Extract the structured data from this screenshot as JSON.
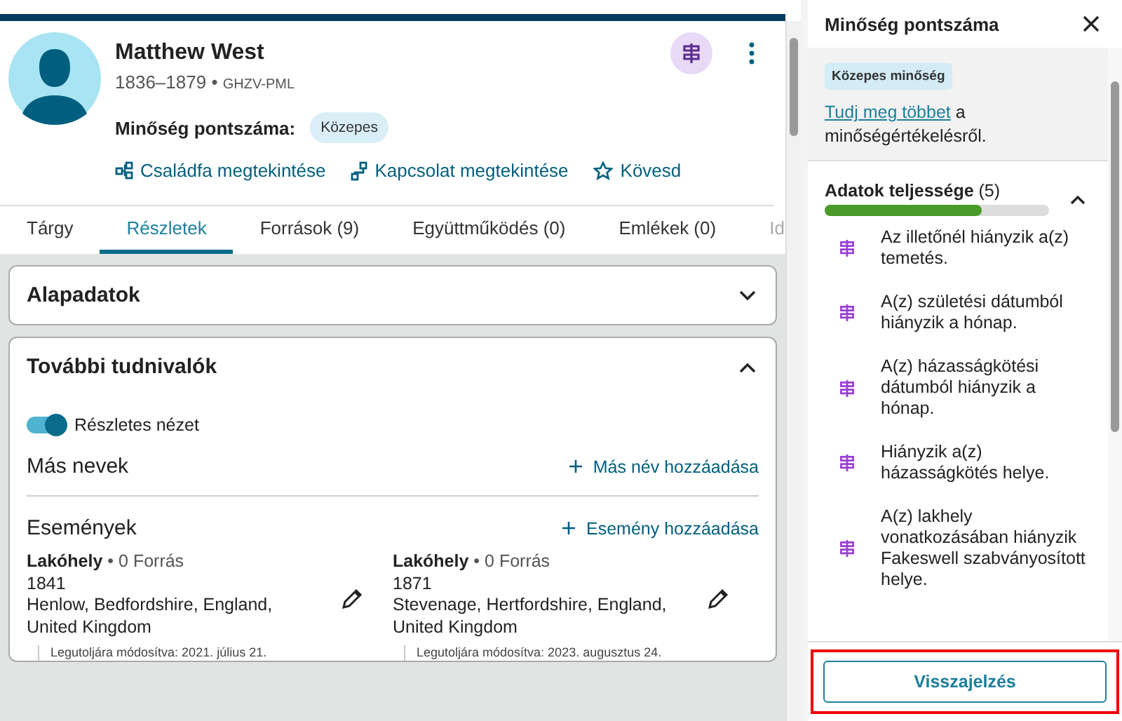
{
  "person": {
    "name": "Matthew West",
    "lifespan": "1836–1879",
    "separator": "•",
    "id": "GHZV-PML",
    "quality_label": "Minőség pontszáma:",
    "quality_badge": "Közepes"
  },
  "actions": [
    {
      "kind": "tree",
      "label": "Családfa megtekintése"
    },
    {
      "kind": "relation",
      "label": "Kapcsolat megtekintése"
    },
    {
      "kind": "star",
      "label": "Kövesd"
    }
  ],
  "tabs": [
    {
      "label": "Tárgy",
      "selected": false
    },
    {
      "label": "Részletek",
      "selected": true
    },
    {
      "label": "Források (9)",
      "selected": false
    },
    {
      "label": "Együttműködés (0)",
      "selected": false
    },
    {
      "label": "Emlékek (0)",
      "selected": false
    },
    {
      "label": "Id",
      "selected": false
    }
  ],
  "sections": [
    {
      "title": "Alapadatok",
      "expanded": false
    },
    {
      "title": "További tudnivalók",
      "expanded": true
    }
  ],
  "detail_toggle": {
    "label": "Részletes nézet",
    "on": true
  },
  "other_names": {
    "title": "Más nevek",
    "add": "Más név hozzáadása"
  },
  "events": {
    "title": "Események",
    "add": "Esemény hozzáadása",
    "items": [
      {
        "type": "Lakóhely",
        "sources": "• 0 Forrás",
        "year": "1841",
        "place": "Henlow, Bedfordshire, England, United Kingdom",
        "modified": "Legutoljára módosítva: 2021. július 21."
      },
      {
        "type": "Lakóhely",
        "sources": "• 0 Forrás",
        "year": "1871",
        "place": "Stevenage, Hertfordshire, England, United Kingdom",
        "modified": "Legutoljára módosítva: 2023. augusztus 24."
      }
    ]
  },
  "panel": {
    "title": "Minőség pontszáma",
    "badge": "Közepes minőség",
    "link": "Tudj meg többet",
    "text": " a minőségértékelésről.",
    "completeness": {
      "title": "Adatok teljessége",
      "count": "(5)",
      "expanded": true,
      "level": 0.7
    },
    "issues": [
      "Az illetőnél hiányzik a(z) temetés.",
      "A(z) születési dátumból hiányzik a hónap.",
      "A(z) házasságkötési dátumból hiányzik a hónap.",
      "Hiányzik a(z) házasságkötés helye.",
      "A(z) lakhely vonatkozásában hiányzik Fakeswell szabványosított helye."
    ],
    "feedback": {
      "label": "Visszajelzés",
      "highlighted": true
    }
  }
}
